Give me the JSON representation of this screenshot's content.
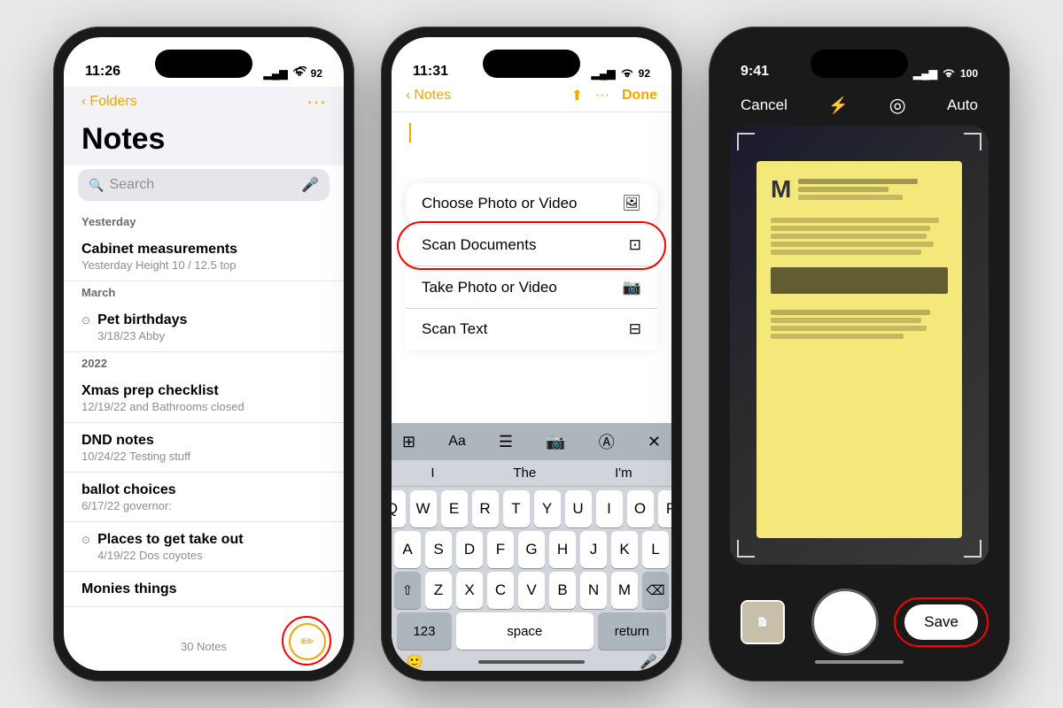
{
  "phone1": {
    "status": {
      "time": "11:26",
      "signal": "▂▄▆",
      "wifi": "WiFi",
      "battery": "92"
    },
    "nav": {
      "back": "Folders",
      "ellipsis": "···"
    },
    "title": "Notes",
    "search_placeholder": "Search",
    "sections": [
      {
        "header": "Yesterday",
        "notes": [
          {
            "title": "Cabinet measurements",
            "meta": "Yesterday  Height 10 / 12.5 top",
            "shared": false
          }
        ]
      },
      {
        "header": "March",
        "notes": [
          {
            "title": "Pet birthdays",
            "meta": "3/18/23  Abby",
            "shared": true
          }
        ]
      },
      {
        "header": "2022",
        "notes": [
          {
            "title": "Xmas prep checklist",
            "meta": "12/19/22  and Bathrooms closed",
            "shared": false
          },
          {
            "title": "DND notes",
            "meta": "10/24/22  Testing stuff",
            "shared": false
          },
          {
            "title": "ballot choices",
            "meta": "6/17/22  governor:",
            "shared": false
          },
          {
            "title": "Places to get take out",
            "meta": "4/19/22  Dos coyotes",
            "shared": true
          },
          {
            "title": "Monies things",
            "meta": "",
            "shared": false
          }
        ]
      }
    ],
    "footer": {
      "count": "30 Notes"
    },
    "compose_label": "✏"
  },
  "phone2": {
    "status": {
      "time": "11:31",
      "signal": "▂▄▆",
      "wifi": "WiFi",
      "battery": "92"
    },
    "nav": {
      "back": "Notes",
      "upload": "⬆",
      "ellipsis": "···",
      "done": "Done"
    },
    "menu_items": [
      {
        "label": "Choose Photo or Video",
        "icon": "🖼",
        "id": "choose-photo"
      },
      {
        "label": "Scan Documents",
        "icon": "⊡",
        "id": "scan-documents",
        "highlighted": true
      },
      {
        "label": "Take Photo or Video",
        "icon": "📷",
        "id": "take-photo"
      },
      {
        "label": "Scan Text",
        "icon": "⊟",
        "id": "scan-text"
      }
    ],
    "keyboard": {
      "suggestions": [
        "I",
        "The",
        "I'm"
      ],
      "rows": [
        [
          "Q",
          "W",
          "E",
          "R",
          "T",
          "Y",
          "U",
          "I",
          "O",
          "P"
        ],
        [
          "A",
          "S",
          "D",
          "F",
          "G",
          "H",
          "J",
          "K",
          "L"
        ],
        [
          "⇧",
          "Z",
          "X",
          "C",
          "V",
          "B",
          "N",
          "M",
          "⌫"
        ],
        [
          "123",
          "space",
          "return"
        ]
      ]
    }
  },
  "phone3": {
    "status": {
      "time": "9:41"
    },
    "top_bar": {
      "cancel": "Cancel",
      "flash": "⚡",
      "lens": "◎",
      "mode": "Auto"
    },
    "save_button": "Save"
  }
}
